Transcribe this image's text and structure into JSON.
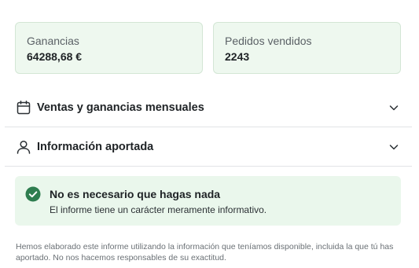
{
  "stats": {
    "earnings": {
      "label": "Ganancias",
      "value": "64288,68 €"
    },
    "orders": {
      "label": "Pedidos vendidos",
      "value": "2243"
    }
  },
  "sections": {
    "monthly": {
      "title": "Ventas y ganancias mensuales",
      "icon": "calendar-icon"
    },
    "info": {
      "title": "Información aportada",
      "icon": "user-icon"
    }
  },
  "notice": {
    "title": "No es necesario que hagas nada",
    "text": "El informe tiene un carácter meramente informativo.",
    "icon": "check-circle-icon",
    "color": "#2e7d4f"
  },
  "disclaimer": "Hemos elaborado este informe utilizando la información que teníamos disponible, incluida la que tú has aportado. No nos hacemos responsables de su exactitud."
}
